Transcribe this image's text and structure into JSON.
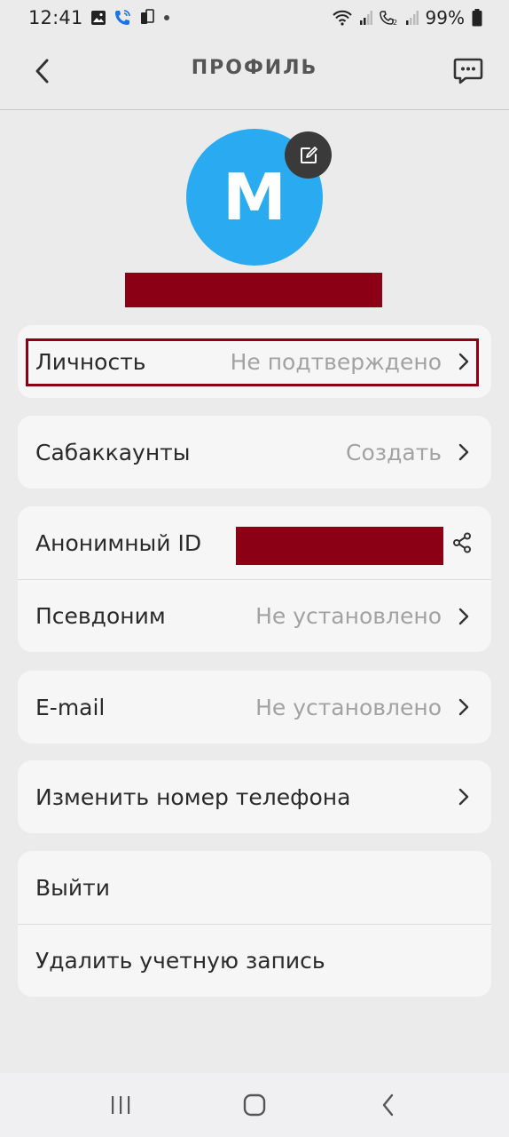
{
  "status_bar": {
    "time": "12:41",
    "battery": "99%",
    "left_icons": [
      "gallery-icon",
      "phone-call-icon",
      "phone-device-icon",
      "dot-icon"
    ],
    "right_icons": [
      "wifi-icon",
      "signal-icon",
      "call-sim2-icon",
      "signal-icon-2",
      "battery-icon"
    ]
  },
  "header": {
    "title": "ПРОФИЛЬ",
    "back_icon": "back-chevron-icon",
    "right_icon": "chat-icon"
  },
  "avatar": {
    "letter": "M",
    "color": "#2aaaf0",
    "edit_icon": "edit-icon"
  },
  "rows": {
    "identity": {
      "label": "Личность",
      "value": "Не подтверждено"
    },
    "subaccounts": {
      "label": "Сабаккаунты",
      "value": "Создать"
    },
    "anon_id": {
      "label": "Анонимный ID",
      "icon": "share-icon"
    },
    "nickname": {
      "label": "Псевдоним",
      "value": "Не установлено"
    },
    "email": {
      "label": "E-mail",
      "value": "Не установлено"
    },
    "change_phone": {
      "label": "Изменить номер телефона"
    },
    "logout": {
      "label": "Выйти"
    },
    "delete_account": {
      "label": "Удалить учетную запись"
    }
  },
  "colors": {
    "redaction": "#8b0014",
    "accent": "#2aaaf0",
    "background": "#ebebeb",
    "card": "#f6f6f6"
  },
  "nav_bar": {
    "icons": [
      "recent-apps-icon",
      "home-icon",
      "back-icon"
    ]
  }
}
